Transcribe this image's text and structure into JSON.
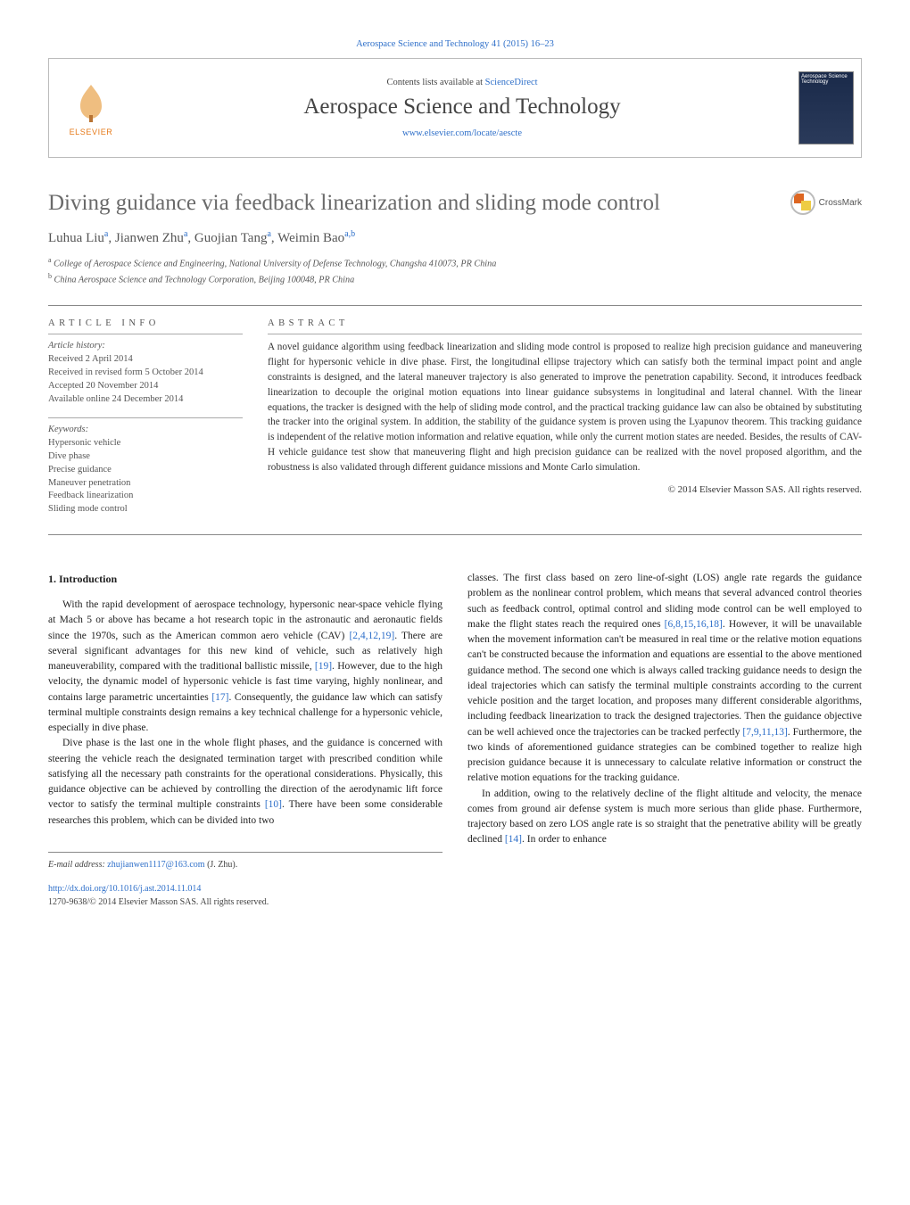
{
  "topline": "Aerospace Science and Technology 41 (2015) 16–23",
  "header": {
    "contents_prefix": "Contents lists available at ",
    "contents_link": "ScienceDirect",
    "journal_name": "Aerospace Science and Technology",
    "journal_link": "www.elsevier.com/locate/aescte",
    "elsevier": "ELSEVIER",
    "cover_text": "Aerospace Science Technology"
  },
  "title": "Diving guidance via feedback linearization and sliding mode control",
  "crossmark": "CrossMark",
  "authors_html": "Luhua Liu",
  "authors": {
    "a1_name": "Luhua Liu",
    "a1_sup": "a",
    "a2_name": "Jianwen Zhu",
    "a2_sup": "a",
    "a3_name": "Guojian Tang",
    "a3_sup": "a",
    "a4_name": "Weimin Bao",
    "a4_sup": "a,b"
  },
  "affiliations": {
    "a_sup": "a",
    "a_text": "College of Aerospace Science and Engineering, National University of Defense Technology, Changsha 410073, PR China",
    "b_sup": "b",
    "b_text": "China Aerospace Science and Technology Corporation, Beijing 100048, PR China"
  },
  "info": {
    "head_info": "article info",
    "head_abs": "abstract",
    "history_label": "Article history:",
    "h1": "Received 2 April 2014",
    "h2": "Received in revised form 5 October 2014",
    "h3": "Accepted 20 November 2014",
    "h4": "Available online 24 December 2014",
    "kw_label": "Keywords:",
    "k1": "Hypersonic vehicle",
    "k2": "Dive phase",
    "k3": "Precise guidance",
    "k4": "Maneuver penetration",
    "k5": "Feedback linearization",
    "k6": "Sliding mode control"
  },
  "abstract": "A novel guidance algorithm using feedback linearization and sliding mode control is proposed to realize high precision guidance and maneuvering flight for hypersonic vehicle in dive phase. First, the longitudinal ellipse trajectory which can satisfy both the terminal impact point and angle constraints is designed, and the lateral maneuver trajectory is also generated to improve the penetration capability. Second, it introduces feedback linearization to decouple the original motion equations into linear guidance subsystems in longitudinal and lateral channel. With the linear equations, the tracker is designed with the help of sliding mode control, and the practical tracking guidance law can also be obtained by substituting the tracker into the original system. In addition, the stability of the guidance system is proven using the Lyapunov theorem. This tracking guidance is independent of the relative motion information and relative equation, while only the current motion states are needed. Besides, the results of CAV-H vehicle guidance test show that maneuvering flight and high precision guidance can be realized with the novel proposed algorithm, and the robustness is also validated through different guidance missions and Monte Carlo simulation.",
  "copyright": "© 2014 Elsevier Masson SAS. All rights reserved.",
  "section1": {
    "head": "1. Introduction"
  },
  "body": {
    "c1p1a": "With the rapid development of aerospace technology, hypersonic near-space vehicle flying at Mach 5 or above has became a hot research topic in the astronautic and aeronautic fields since the 1970s, such as the American common aero vehicle (CAV) ",
    "c1p1_ref1": "[2,4,12,19]",
    "c1p1b": ". There are several significant advantages for this new kind of vehicle, such as relatively high maneuverability, compared with the traditional ballistic missile, ",
    "c1p1_ref2": "[19]",
    "c1p1c": ". However, due to the high velocity, the dynamic model of hypersonic vehicle is fast time varying, highly nonlinear, and contains large parametric uncertainties ",
    "c1p1_ref3": "[17]",
    "c1p1d": ". Consequently, the guidance law which can satisfy terminal multiple constraints design remains a key technical challenge for a hypersonic vehicle, especially in dive phase.",
    "c1p2a": "Dive phase is the last one in the whole flight phases, and the guidance is concerned with steering the vehicle reach the designated termination target with prescribed condition while satisfying all the necessary path constraints for the operational considerations. Physically, this guidance objective can be achieved by controlling the direction of the aerodynamic lift force vector to satisfy the terminal multiple constraints ",
    "c1p2_ref1": "[10]",
    "c1p2b": ". There have been some considerable researches this problem, which can be divided into two",
    "c2p1a": "classes. The first class based on zero line-of-sight (LOS) angle rate regards the guidance problem as the nonlinear control problem, which means that several advanced control theories such as feedback control, optimal control and sliding mode control can be well employed to make the flight states reach the required ones ",
    "c2p1_ref1": "[6,8,15,16,18]",
    "c2p1b": ". However, it will be unavailable when the movement information can't be measured in real time or the relative motion equations can't be constructed because the information and equations are essential to the above mentioned guidance method. The second one which is always called tracking guidance needs to design the ideal trajectories which can satisfy the terminal multiple constraints according to the current vehicle position and the target location, and proposes many different considerable algorithms, including feedback linearization to track the designed trajectories. Then the guidance objective can be well achieved once the trajectories can be tracked perfectly ",
    "c2p1_ref2": "[7,9,11,13]",
    "c2p1c": ". Furthermore, the two kinds of aforementioned guidance strategies can be combined together to realize high precision guidance because it is unnecessary to calculate relative information or construct the relative motion equations for the tracking guidance.",
    "c2p2a": "In addition, owing to the relatively decline of the flight altitude and velocity, the menace comes from ground air defense system is much more serious than glide phase. Furthermore, trajectory based on zero LOS angle rate is so straight that the penetrative ability will be greatly declined ",
    "c2p2_ref1": "[14]",
    "c2p2b": ". In order to enhance"
  },
  "footer": {
    "email_label": "E-mail address:",
    "email": "zhujianwen1117@163.com",
    "email_who": "(J. Zhu).",
    "doi": "http://dx.doi.org/10.1016/j.ast.2014.11.014",
    "issn_line": "1270-9638/© 2014 Elsevier Masson SAS. All rights reserved."
  }
}
